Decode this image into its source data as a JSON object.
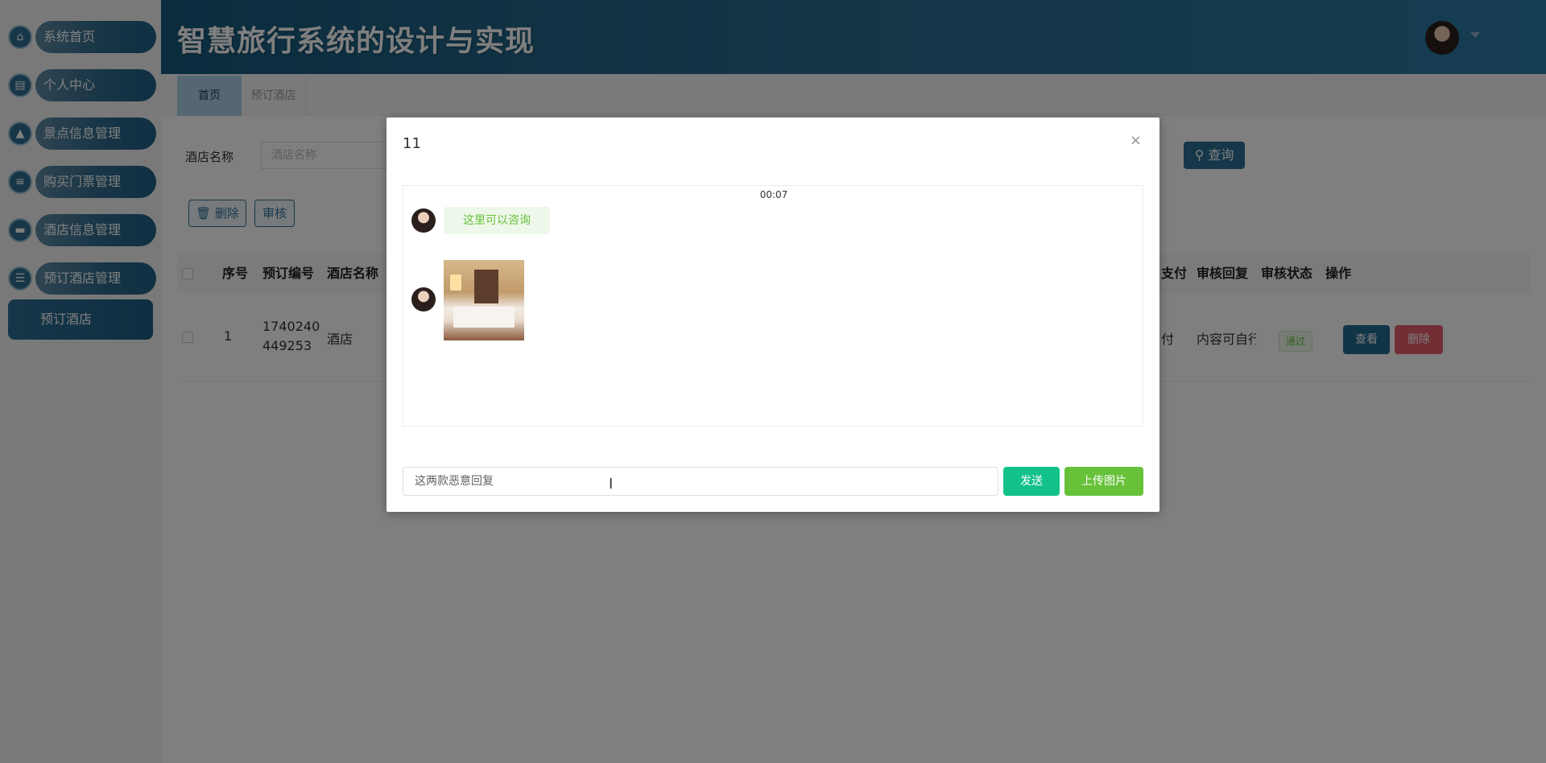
{
  "sidebar": {
    "items": [
      {
        "label": "系统首页",
        "icon": "home-icon"
      },
      {
        "label": "个人中心",
        "icon": "user-card-icon"
      },
      {
        "label": "景点信息管理",
        "icon": "scenic-icon"
      },
      {
        "label": "购买门票管理",
        "icon": "ticket-sliders-icon"
      },
      {
        "label": "酒店信息管理",
        "icon": "hotel-icon"
      },
      {
        "label": "预订酒店管理",
        "icon": "list-icon"
      }
    ],
    "sub_item": "预订酒店"
  },
  "header": {
    "title": "智慧旅行系统的设计与实现"
  },
  "tabs": [
    {
      "label": "首页"
    },
    {
      "label": "预订酒店"
    }
  ],
  "search": {
    "label": "酒店名称",
    "placeholder": "酒店名称",
    "query_button": "查询"
  },
  "actions": {
    "delete": "删除",
    "review": "审核"
  },
  "table": {
    "columns": [
      "序号",
      "预订编号",
      "酒店名称",
      "支付",
      "审核回复",
      "审核状态",
      "操作"
    ],
    "rows": [
      {
        "index": "1",
        "order_no_line1": "1740240",
        "order_no_line2": "449253",
        "hotel": "酒店",
        "pay": "付",
        "reply": "内容可自行",
        "status": "通过",
        "view": "查看",
        "delete": "删除"
      }
    ]
  },
  "modal": {
    "title": "11",
    "close": "×",
    "time": "00:07",
    "message_text": "这里可以咨询",
    "input_value": "这两款恶意回复",
    "send_button": "发送",
    "upload_button": "上传图片"
  },
  "colors": {
    "primary": "#2a6f93",
    "success": "#67c23a",
    "send": "#13c28b",
    "danger": "#e25f6a"
  }
}
